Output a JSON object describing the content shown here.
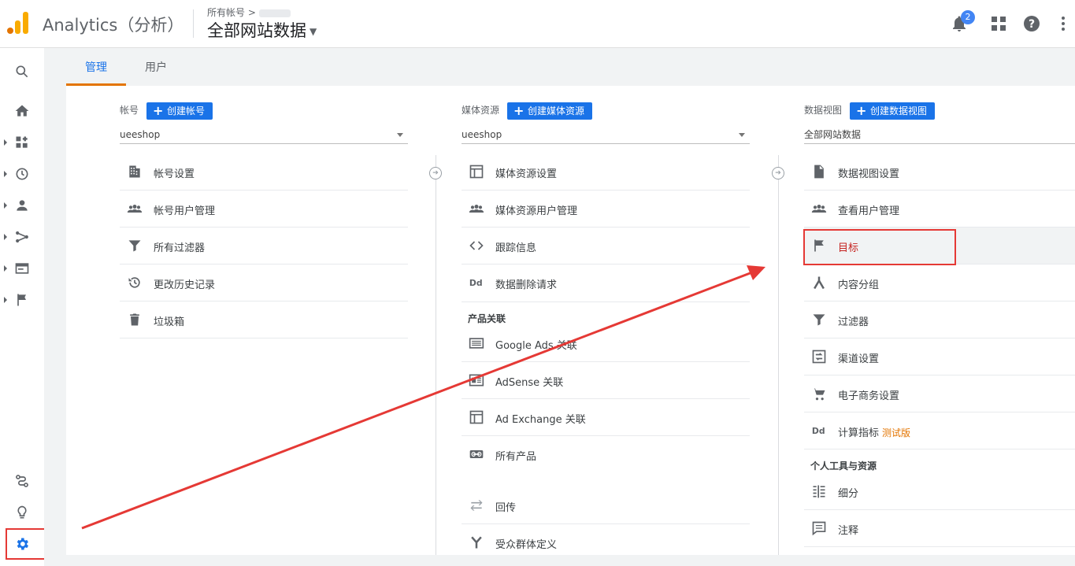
{
  "header": {
    "app_title": "Analytics（分析）",
    "breadcrumb": "所有帐号 >",
    "view_title": "全部网站数据",
    "notification_count": "2"
  },
  "tabs": [
    "管理",
    "用户"
  ],
  "columns": {
    "account": {
      "label": "帐号",
      "create_label": "创建帐号",
      "selected": "ueeshop",
      "items": [
        "帐号设置",
        "帐号用户管理",
        "所有过滤器",
        "更改历史记录",
        "垃圾箱"
      ]
    },
    "property": {
      "label": "媒体资源",
      "create_label": "创建媒体资源",
      "selected": "ueeshop",
      "items": [
        "媒体资源设置",
        "媒体资源用户管理",
        "跟踪信息",
        "数据删除请求"
      ],
      "section_title": "产品关联",
      "product_items": [
        "Google Ads 关联",
        "AdSense 关联",
        "Ad Exchange 关联",
        "所有产品"
      ],
      "extra_items": [
        "回传",
        "受众群体定义"
      ]
    },
    "view": {
      "label": "数据视图",
      "create_label": "创建数据视图",
      "selected": "全部网站数据",
      "items": [
        "数据视图设置",
        "查看用户管理",
        "目标",
        "内容分组",
        "过滤器",
        "渠道设置",
        "电子商务设置",
        "计算指标"
      ],
      "trial_badge": "测试版",
      "section_title": "个人工具与资源",
      "tool_items": [
        "细分",
        "注释"
      ]
    }
  },
  "colors": {
    "accent_blue": "#1a73e8",
    "tab_underline": "#e37400",
    "annotation_red": "#e53935"
  }
}
